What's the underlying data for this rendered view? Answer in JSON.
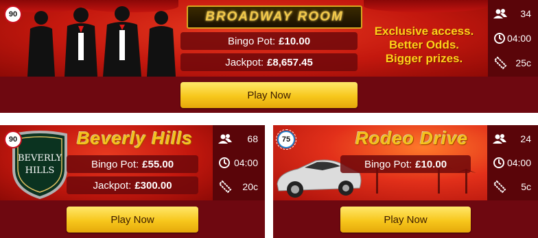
{
  "rooms": [
    {
      "ball": "90",
      "title": "BROADWAY ROOM",
      "bingo_pot_label": "Bingo Pot:",
      "bingo_pot_value": "£10.00",
      "jackpot_label": "Jackpot:",
      "jackpot_value": "£8,657.45",
      "tagline": [
        "Exclusive access.",
        "Better Odds.",
        "Bigger prizes."
      ],
      "players": "34",
      "time": "04:00",
      "ticket_price": "25c",
      "play_label": "Play Now"
    },
    {
      "ball": "90",
      "title": "Beverly Hills",
      "badge_lines": [
        "BEVERLY",
        "HILLS"
      ],
      "bingo_pot_label": "Bingo Pot:",
      "bingo_pot_value": "£55.00",
      "jackpot_label": "Jackpot:",
      "jackpot_value": "£300.00",
      "players": "68",
      "time": "04:00",
      "ticket_price": "20c",
      "play_label": "Play Now"
    },
    {
      "ball": "75",
      "title": "Rodeo Drive",
      "bingo_pot_label": "Bingo Pot:",
      "bingo_pot_value": "£10.00",
      "players": "24",
      "time": "04:00",
      "ticket_price": "5c",
      "play_label": "Play Now"
    }
  ],
  "colors": {
    "banner_red": "#c4180e",
    "bottom_maroon": "#6e0810",
    "sidebar": "#5a0509",
    "button_gold": "#f7c71c",
    "title_gold": "#f7c21c"
  },
  "icons": [
    "players-icon",
    "clock-icon",
    "ticket-icon"
  ]
}
